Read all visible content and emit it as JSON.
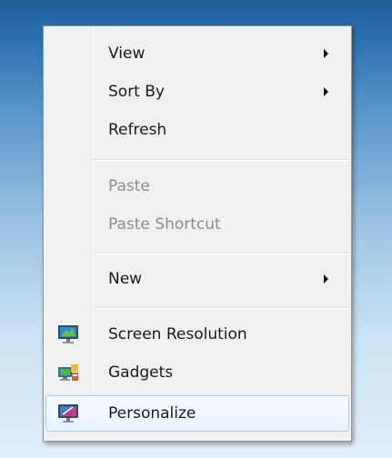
{
  "context_menu": {
    "items": [
      {
        "label": "View",
        "has_submenu": true,
        "enabled": true
      },
      {
        "label": "Sort By",
        "has_submenu": true,
        "enabled": true
      },
      {
        "label": "Refresh",
        "has_submenu": false,
        "enabled": true
      },
      {
        "label": "Paste",
        "has_submenu": false,
        "enabled": false
      },
      {
        "label": "Paste Shortcut",
        "has_submenu": false,
        "enabled": false
      },
      {
        "label": "New",
        "has_submenu": true,
        "enabled": true
      },
      {
        "label": "Screen Resolution",
        "icon": "monitor-resolution-icon",
        "enabled": true
      },
      {
        "label": "Gadgets",
        "icon": "gadgets-icon",
        "enabled": true
      },
      {
        "label": "Personalize",
        "icon": "personalize-icon",
        "enabled": true,
        "hovered": true
      }
    ]
  },
  "colors": {
    "desktop_top": "#1f5e97",
    "desktop_bottom": "#e3f0fa",
    "menu_background": "#f0f0f0",
    "hover_border": "#aeccf2",
    "disabled_text": "#8d8d8d"
  }
}
